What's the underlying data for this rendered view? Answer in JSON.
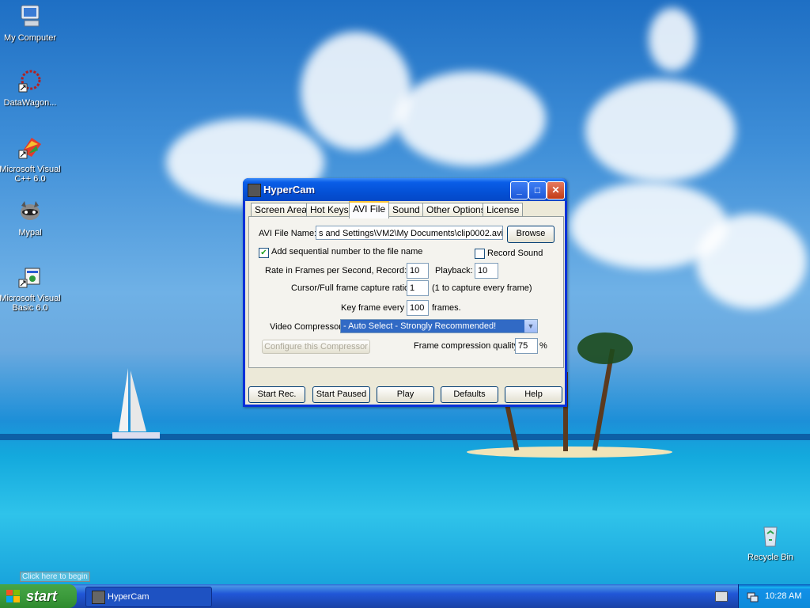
{
  "desktop": {
    "icons": [
      {
        "label": "My Computer",
        "icon": "my-computer-icon"
      },
      {
        "label": "DataWagon...",
        "icon": "datawagon-icon"
      },
      {
        "label": "Microsoft Visual C++ 6.0",
        "icon": "visual-cpp-icon"
      },
      {
        "label": "Mypal",
        "icon": "mypal-icon"
      },
      {
        "label": "Microsoft Visual Basic 6.0",
        "icon": "visual-basic-icon"
      },
      {
        "label": "Recycle Bin",
        "icon": "recycle-bin-icon"
      }
    ],
    "tooltip": "Click here to begin"
  },
  "window": {
    "title": "HyperCam",
    "tabs": [
      "Screen Area",
      "Hot Keys",
      "AVI File",
      "Sound",
      "Other Options",
      "License"
    ],
    "active_tab": "AVI File",
    "avi_file_name_label": "AVI File Name:",
    "avi_file_name_value": "s and Settings\\VM2\\My Documents\\clip0002.avi",
    "browse_label": "Browse",
    "add_sequential_label": "Add sequential number to the file name",
    "add_sequential_checked": true,
    "record_sound_label": "Record Sound",
    "record_sound_checked": false,
    "rate_label": "Rate in Frames per Second,  Record:",
    "record_rate": "10",
    "playback_label": "Playback:",
    "playback_rate": "10",
    "cursor_ratio_label": "Cursor/Full frame capture ratio",
    "cursor_ratio_value": "1",
    "cursor_ratio_hint": "(1 to capture every frame)",
    "key_frame_label": "Key frame every",
    "key_frame_value": "100",
    "key_frame_unit": "frames.",
    "compressor_label": "Video Compressor:",
    "compressor_value": "- Auto Select - Strongly Recommended!",
    "configure_label": "Configure this Compressor",
    "quality_label": "Frame compression quality",
    "quality_value": "75",
    "quality_unit": "%",
    "buttons": [
      "Start Rec.",
      "Start Paused",
      "Play",
      "Defaults",
      "Help"
    ]
  },
  "taskbar": {
    "start_label": "start",
    "task_label": "HyperCam",
    "clock": "10:28 AM"
  },
  "colors": {
    "xp_blue": "#0831d9",
    "start_green": "#3c9b3c",
    "selection": "#316ac5"
  }
}
